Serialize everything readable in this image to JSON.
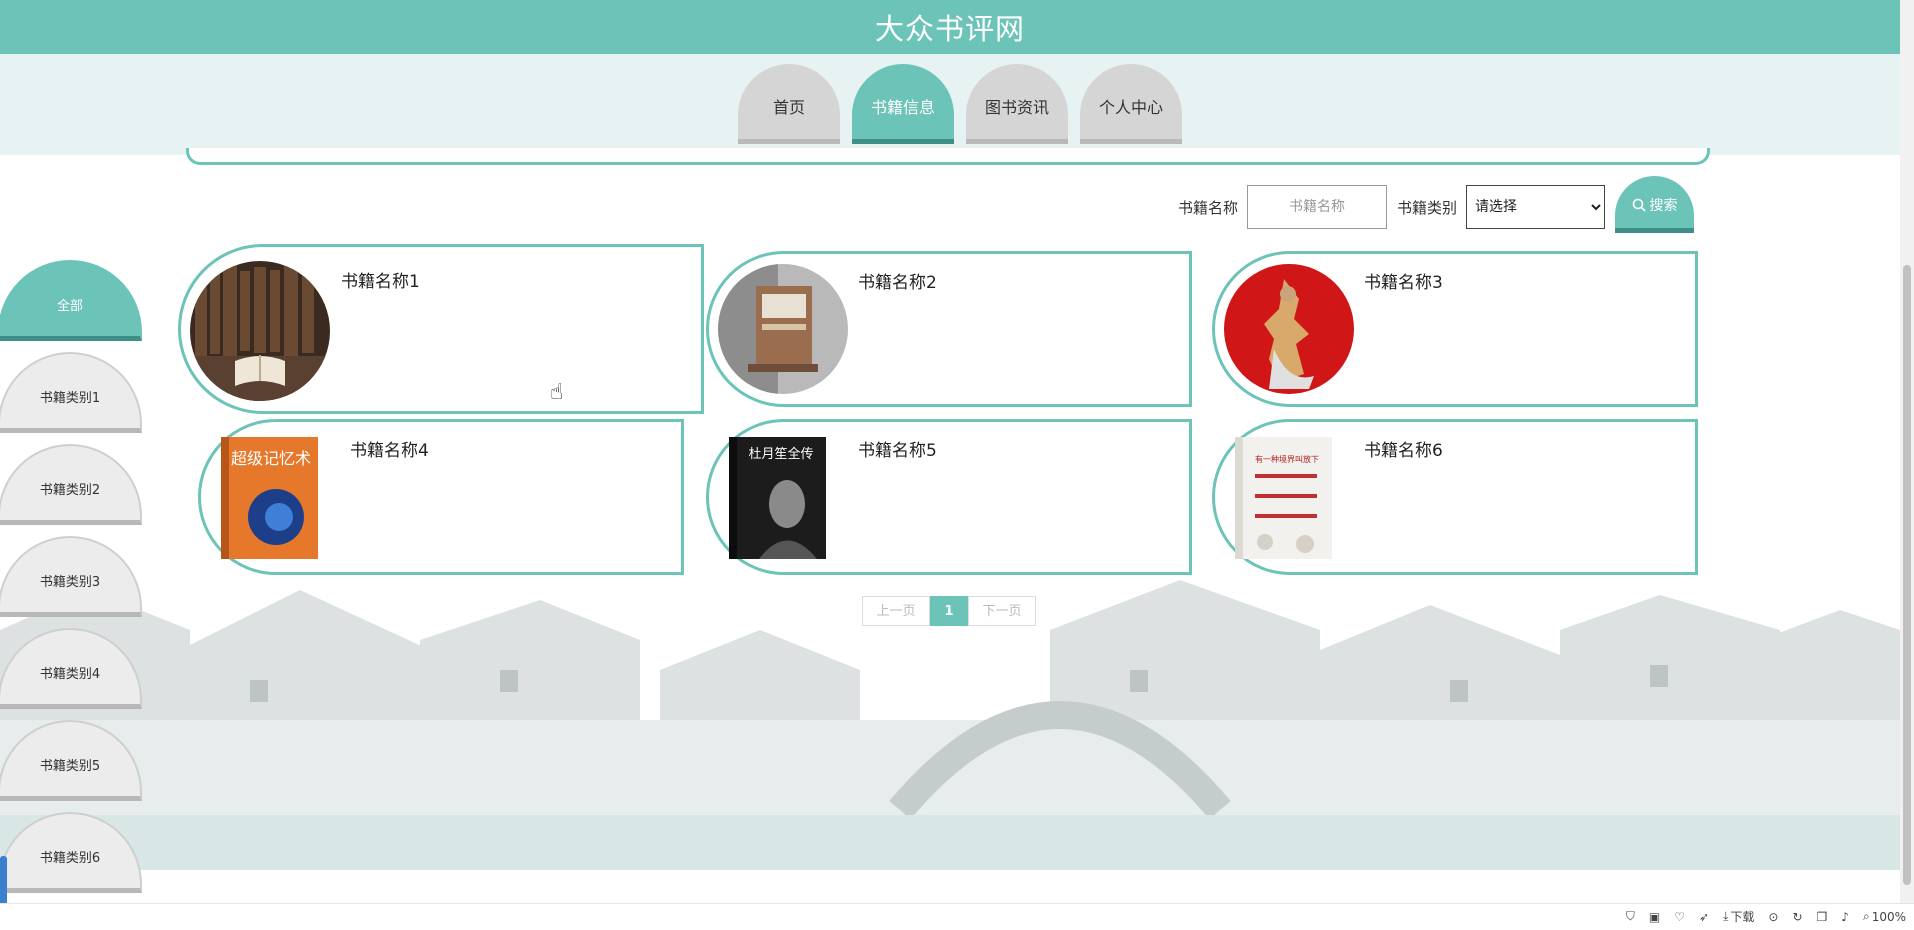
{
  "header": {
    "site_title": "大众书评网"
  },
  "nav": {
    "tabs": [
      {
        "label": "首页",
        "active": false
      },
      {
        "label": "书籍信息",
        "active": true
      },
      {
        "label": "图书资讯",
        "active": false
      },
      {
        "label": "个人中心",
        "active": false
      }
    ]
  },
  "search": {
    "name_label": "书籍名称",
    "name_placeholder": "书籍名称",
    "category_label": "书籍类别",
    "category_selected": "请选择",
    "button_label": "搜索"
  },
  "sidebar": {
    "items": [
      {
        "label": "全部",
        "active": true
      },
      {
        "label": "书籍类别1",
        "active": false
      },
      {
        "label": "书籍类别2",
        "active": false
      },
      {
        "label": "书籍类别3",
        "active": false
      },
      {
        "label": "书籍类别4",
        "active": false
      },
      {
        "label": "书籍类别5",
        "active": false
      },
      {
        "label": "书籍类别6",
        "active": false
      }
    ]
  },
  "books": [
    {
      "name": "书籍名称1",
      "cover": "library-books-image"
    },
    {
      "name": "书籍名称2",
      "cover": "book-display-image"
    },
    {
      "name": "书籍名称3",
      "cover": "red-figurine-image"
    },
    {
      "name": "书籍名称4",
      "cover": "memory-book-image",
      "cover_text": "超级记忆术"
    },
    {
      "name": "书籍名称5",
      "cover": "biography-book-image",
      "cover_text": "杜月笙全传"
    },
    {
      "name": "书籍名称6",
      "cover": "white-book-image",
      "cover_text": "有一种境界叫放下"
    }
  ],
  "pagination": {
    "prev": "上一页",
    "current": "1",
    "next": "下一页"
  },
  "statusbar": {
    "download_label": "下载",
    "zoom": "100%"
  },
  "colors": {
    "accent": "#6cc3b8",
    "accent_dark": "#3f8f89",
    "tab_inactive": "#d5d5d5"
  }
}
